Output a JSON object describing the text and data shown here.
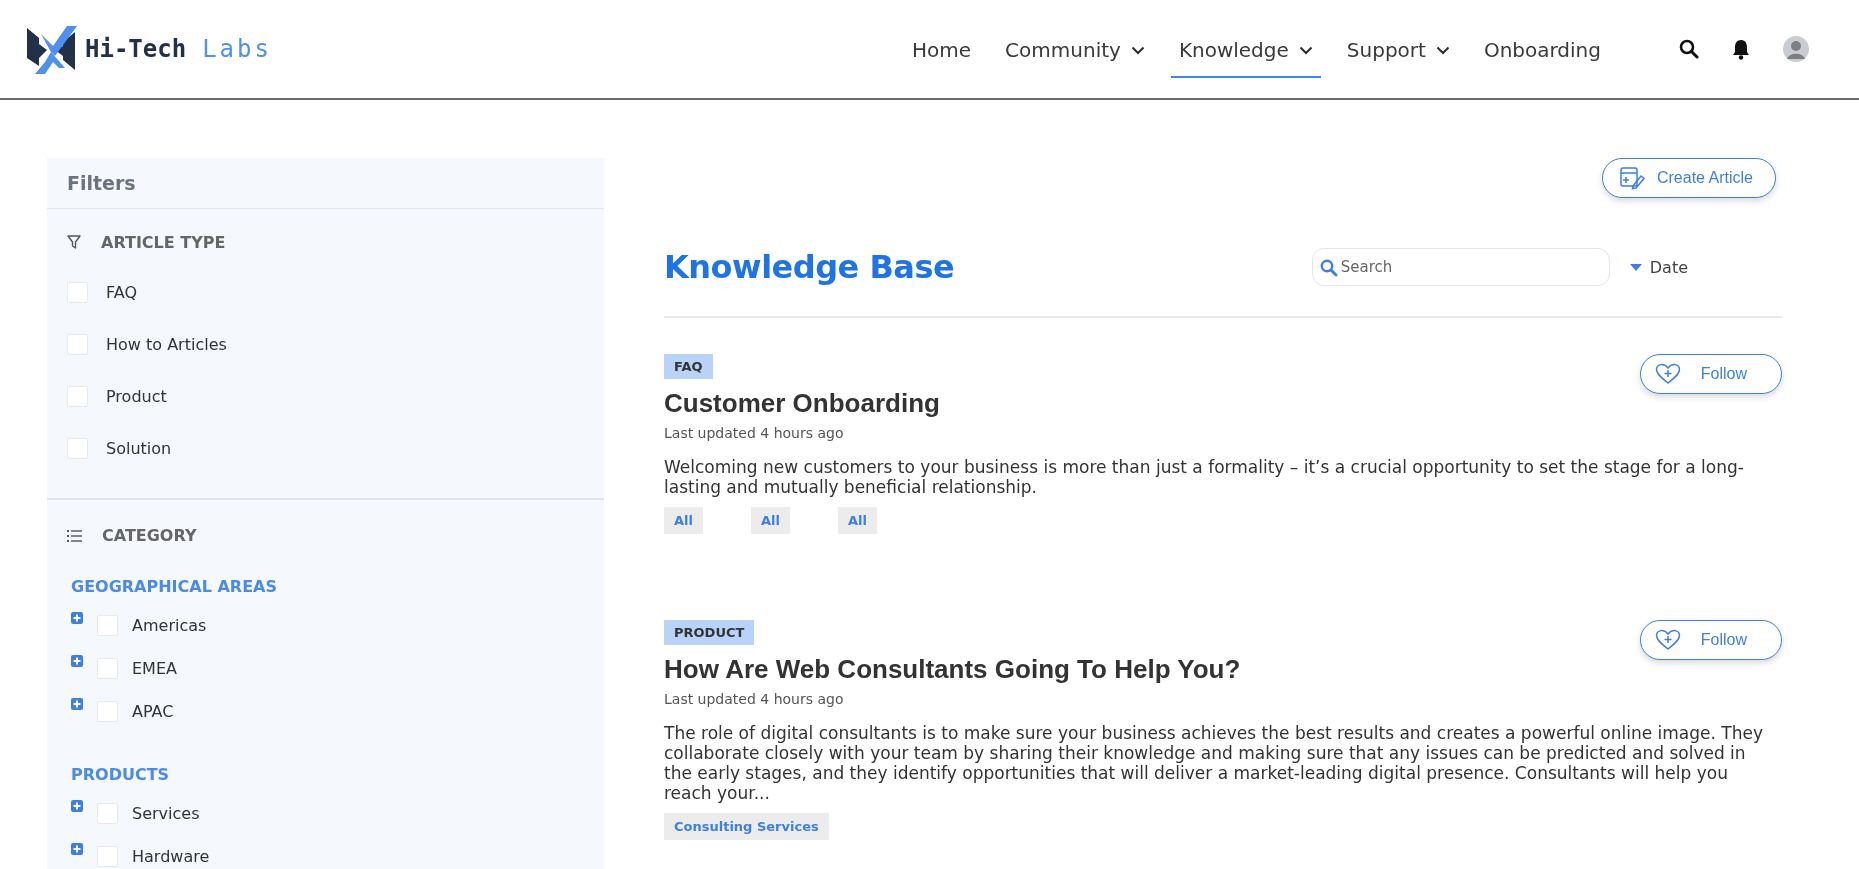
{
  "logo": {
    "word_dark": "Hi-Tech",
    "word_accent": "Labs"
  },
  "nav": [
    {
      "label": "Home",
      "dropdown": false,
      "selected": false
    },
    {
      "label": "Community",
      "dropdown": true,
      "selected": false
    },
    {
      "label": "Knowledge",
      "dropdown": true,
      "selected": true
    },
    {
      "label": "Support",
      "dropdown": true,
      "selected": false
    },
    {
      "label": "Onboarding",
      "dropdown": false,
      "selected": false
    }
  ],
  "filters": {
    "title": "Filters",
    "article_type": {
      "heading": "ARTICLE TYPE",
      "items": [
        {
          "label": "FAQ",
          "checked": false
        },
        {
          "label": "How to Articles",
          "checked": false
        },
        {
          "label": "Product",
          "checked": false
        },
        {
          "label": "Solution",
          "checked": false
        }
      ]
    },
    "category": {
      "heading": "CATEGORY",
      "groups": [
        {
          "heading": "GEOGRAPHICAL AREAS",
          "items": [
            {
              "label": "Americas",
              "checked": false,
              "expanded": false
            },
            {
              "label": "EMEA",
              "checked": false,
              "expanded": false
            },
            {
              "label": "APAC",
              "checked": false,
              "expanded": false
            }
          ]
        },
        {
          "heading": "PRODUCTS",
          "items": [
            {
              "label": "Services",
              "checked": false,
              "expanded": false
            },
            {
              "label": "Hardware",
              "checked": false,
              "expanded": false
            }
          ]
        }
      ]
    }
  },
  "create_button": "Create Article",
  "page_title": "Knowledge Base",
  "search": {
    "placeholder": "Search"
  },
  "sort": {
    "label": "Date"
  },
  "articles": [
    {
      "type": "FAQ",
      "title": "Customer Onboarding",
      "updated": "Last updated 4 hours ago",
      "summary": "Welcoming new customers to your business is more than just a formality – it’s a crucial opportunity to set the stage for a long-lasting and mutually beneficial relationship.",
      "tags": [
        "All",
        "All",
        "All"
      ],
      "follow": "Follow"
    },
    {
      "type": "PRODUCT",
      "title": "How Are Web Consultants Going To Help You?",
      "updated": "Last updated 4 hours ago",
      "summary": "The role of digital consultants is to make sure your business achieves the best results and creates a powerful online image. They collaborate closely with your team by sharing their knowledge and making sure that any issues can be predicted and solved in the early stages, and they identify opportunities that will deliver a market-leading digital presence. Consultants will help you reach your...",
      "tags": [
        "Consulting Services"
      ],
      "follow": "Follow"
    }
  ]
}
